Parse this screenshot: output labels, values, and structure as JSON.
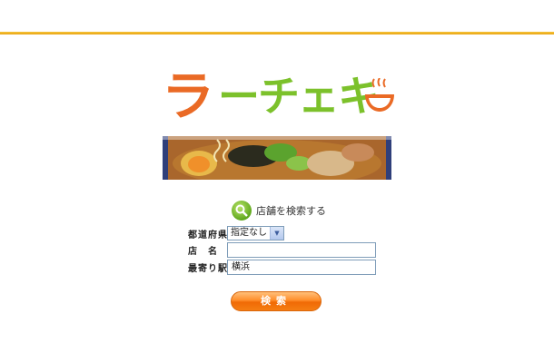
{
  "logo": {
    "text_ra": "ラ",
    "text_rest": "ーチェキ",
    "icon": "ramen-bowl-icon"
  },
  "banner": {
    "image": "ramen-photo"
  },
  "search": {
    "heading_icon": "magnifier-icon",
    "heading": "店舗を検索する",
    "prefecture_label": "都道府県",
    "prefecture_value": "指定なし",
    "shop_name_label": "店　名",
    "shop_name_value": "",
    "station_label": "最寄り駅",
    "station_value": "横浜",
    "button_label": "検索"
  },
  "colors": {
    "accent_orange": "#ea6a25",
    "logo_green": "#7cc12b",
    "rule_yellow": "#f0b429"
  }
}
